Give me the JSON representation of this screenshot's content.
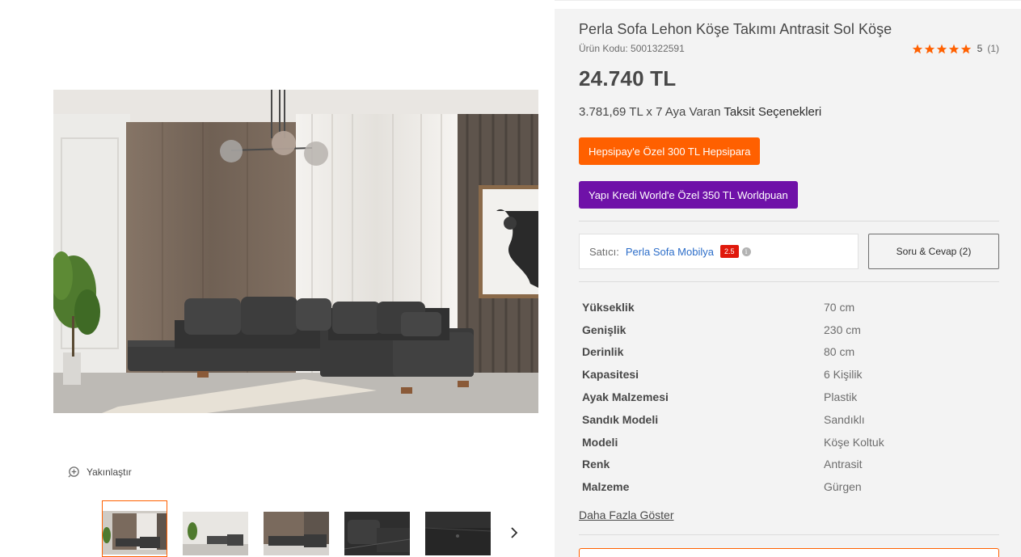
{
  "product": {
    "title": "Perla Sofa Lehon Köşe Takımı Antrasit Sol Köşe",
    "sku_label": "Ürün Kodu: 5001322591",
    "rating_value": "5",
    "rating_count": "(1)",
    "price": "24.740 TL",
    "installment_text": "3.781,69 TL x 7 Aya Varan ",
    "installment_link": "Taksit Seçenekleri"
  },
  "promos": {
    "hepsipay": "Hepsipay'e Özel 300 TL Hepsipara",
    "worldpuan": "Yapı Kredi World'e Özel 350 TL Worldpuan"
  },
  "seller": {
    "label": "Satıcı:",
    "name": "Perla Sofa Mobilya",
    "score": "2.5",
    "info_glyph": "i"
  },
  "qa_button": "Soru & Cevap (2)",
  "specs": [
    {
      "key": "Yükseklik",
      "value": "70 cm"
    },
    {
      "key": "Genişlik",
      "value": "230 cm"
    },
    {
      "key": "Derinlik",
      "value": "80 cm"
    },
    {
      "key": "Kapasitesi",
      "value": "6 Kişilik"
    },
    {
      "key": "Ayak Malzemesi",
      "value": "Plastik"
    },
    {
      "key": "Sandık Modeli",
      "value": "Sandıklı"
    },
    {
      "key": "Modeli",
      "value": "Köşe Koltuk"
    },
    {
      "key": "Renk",
      "value": "Antrasit"
    },
    {
      "key": "Malzeme",
      "value": "Gürgen"
    }
  ],
  "show_more": "Daha Fazla Göster",
  "gallery": {
    "zoom_label": "Yakınlaştır",
    "zoom_icon": "zoom-in-icon",
    "next_icon": "chevron-right-icon",
    "active_thumb": 1
  },
  "colors": {
    "accent": "#ff6000",
    "purple": "#6f11a8",
    "star": "#ff6000",
    "seller_link": "#2d6ec9",
    "score_badge": "#e0190c"
  }
}
